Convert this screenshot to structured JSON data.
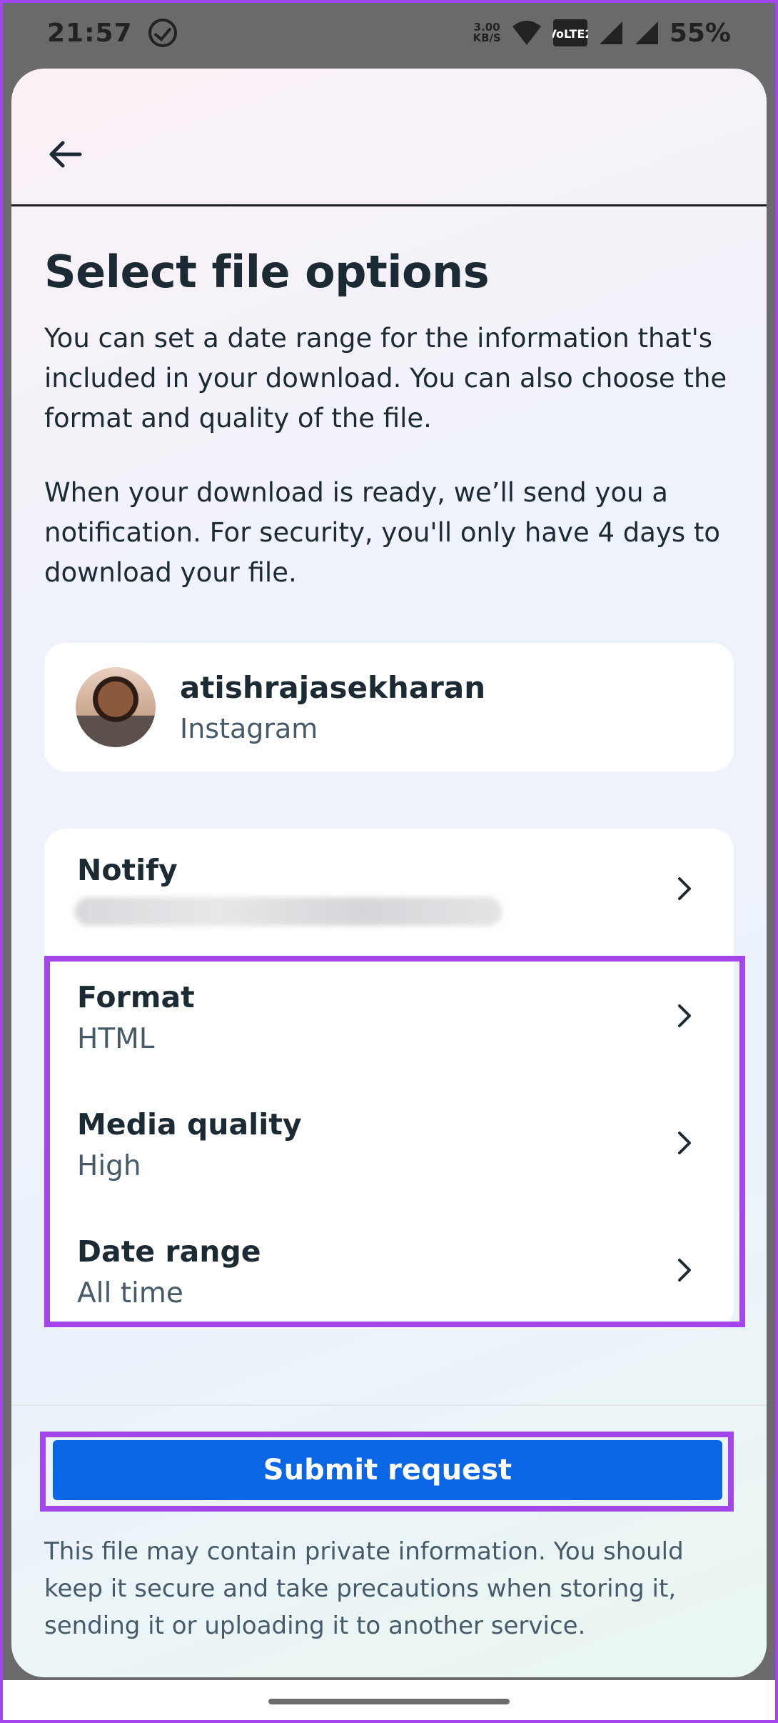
{
  "status_bar": {
    "time": "21:57",
    "speed_value": "3.00",
    "speed_unit": "KB/S",
    "network": "VoLTE2",
    "battery": "55%"
  },
  "header": {
    "back_icon": "arrow-left-icon"
  },
  "page": {
    "title": "Select file options",
    "paragraph1": "You can set a date range for the information that's included in your download. You can also choose the format and quality of the file.",
    "paragraph2": "When your download is ready, we’ll send you a notification. For security, you'll only have 4 days to download your file."
  },
  "account": {
    "username": "atishrajasekharan",
    "platform": "Instagram"
  },
  "settings": [
    {
      "label": "Notify",
      "value": ""
    },
    {
      "label": "Format",
      "value": "HTML"
    },
    {
      "label": "Media quality",
      "value": "High"
    },
    {
      "label": "Date range",
      "value": "All time"
    }
  ],
  "submit_label": "Submit request",
  "disclaimer": "This file may contain private information. You should keep it secure and take precautions when storing it, sending it or uploading it to another service.",
  "colors": {
    "accent": "#0a66e4",
    "highlight": "#a347ec"
  }
}
